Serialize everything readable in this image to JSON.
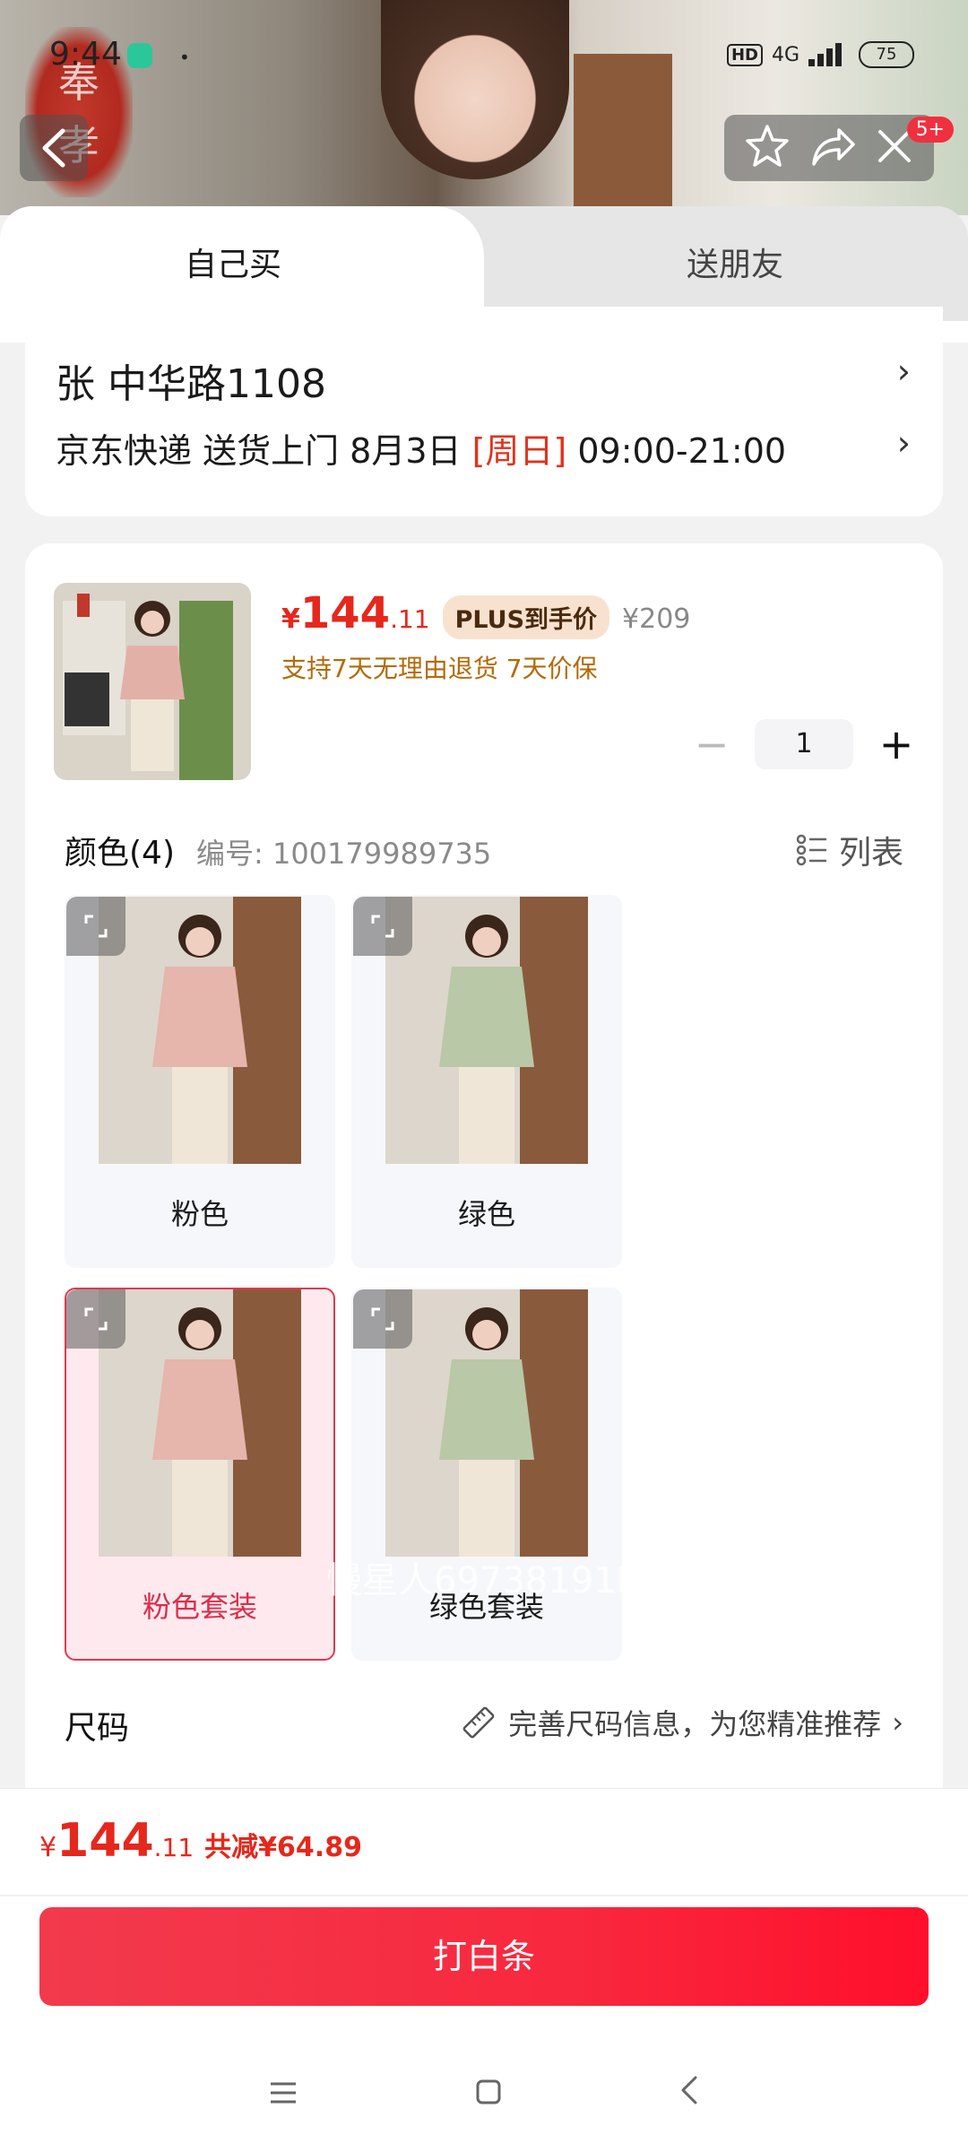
{
  "status_bar": {
    "time": "9:44",
    "network": "HD",
    "network_type": "4G",
    "battery": "75"
  },
  "hero": {
    "seal_chars": [
      "奉",
      "孝"
    ]
  },
  "header": {
    "badge": "5+",
    "icons": [
      "back-icon",
      "star-icon",
      "share-icon",
      "close-icon"
    ]
  },
  "tabs": {
    "self": "自己买",
    "friend": "送朋友"
  },
  "address": {
    "name": "张",
    "street": "中华路1108",
    "delivery_prefix": "京东快递 送货上门 8月3日",
    "weekday": "[周日]",
    "time_window": "09:00-21:00"
  },
  "product": {
    "currency": "¥",
    "price_int": "144",
    "price_dec": ".11",
    "plus_tag": "PLUS到手价",
    "original_price": "¥209",
    "guarantee": "支持7天无理由退货  7天价保",
    "quantity": "1",
    "minus": "−",
    "plus": "+"
  },
  "color_section": {
    "title": "颜色(4)",
    "code": "编号: 100179989735",
    "list_label": "列表",
    "swatches": [
      {
        "label": "粉色",
        "selected": false,
        "color": "#e6b5ac"
      },
      {
        "label": "绿色",
        "selected": false,
        "color": "#b9c8a6"
      },
      {
        "label": "粉色套装",
        "selected": true,
        "color": "#e6b5ac"
      },
      {
        "label": "绿色套装",
        "selected": false,
        "color": "#b9c8a6"
      }
    ]
  },
  "size_section": {
    "title": "尺码",
    "hint": "完善尺码信息，为您精准推荐"
  },
  "watermark": "慢星人69738191K",
  "footer": {
    "currency": "¥",
    "total_int": "144",
    "total_dec": ".11",
    "saved": "共减¥64.89",
    "buy_label": "打白条"
  },
  "colors": {
    "accent": "#e6271c",
    "button": "#f8283e",
    "selected_border": "#e3384d"
  }
}
